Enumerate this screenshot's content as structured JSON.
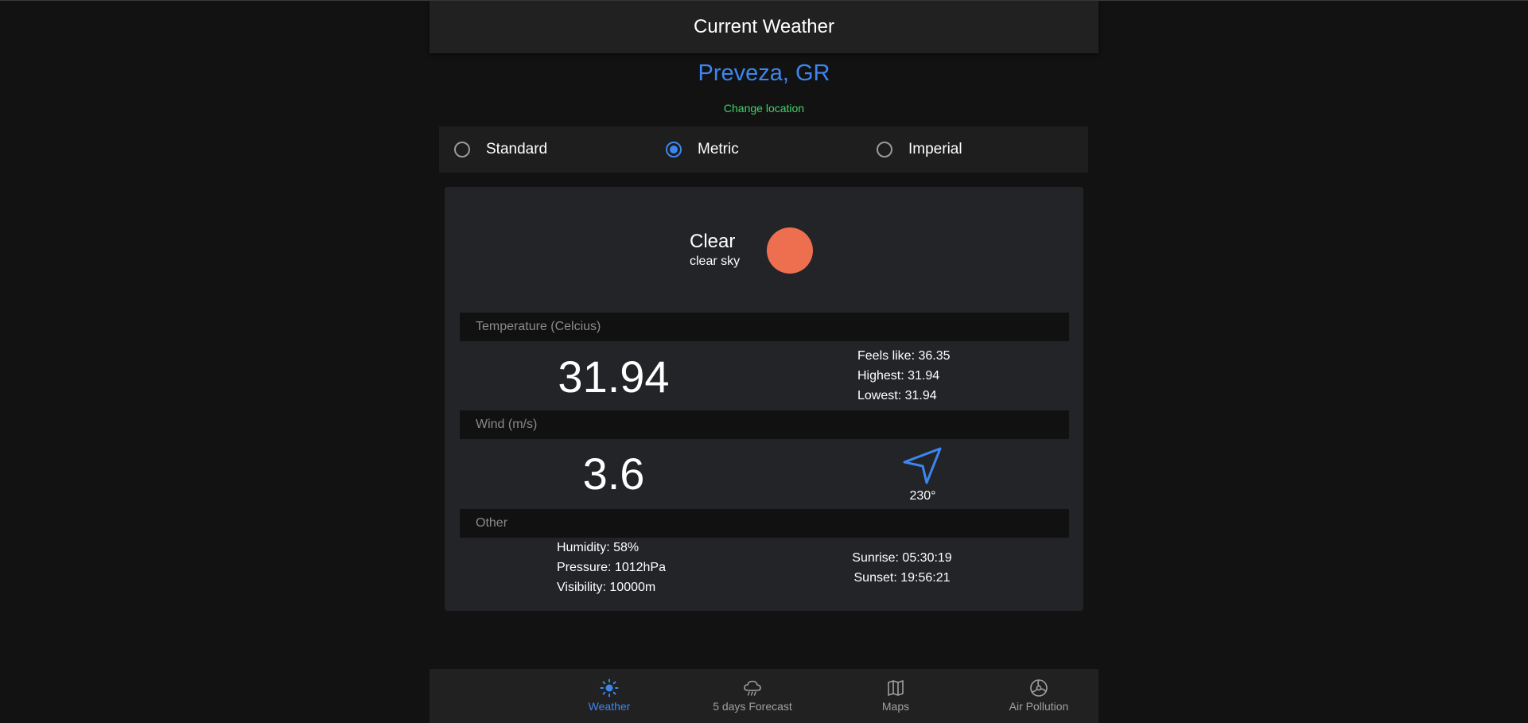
{
  "appbar": {
    "title": "Current Weather"
  },
  "location": {
    "name": "Preveza, GR",
    "change_label": "Change location"
  },
  "units": {
    "options": [
      {
        "label": "Standard",
        "checked": false
      },
      {
        "label": "Metric",
        "checked": true
      },
      {
        "label": "Imperial",
        "checked": false
      }
    ]
  },
  "condition": {
    "main": "Clear",
    "description": "clear sky",
    "icon": "sun-icon"
  },
  "temperature": {
    "header": "Temperature (Celcius)",
    "value": "31.94",
    "feels_like": "Feels like: 36.35",
    "highest": "Highest: 31.94",
    "lowest": "Lowest: 31.94"
  },
  "wind": {
    "header": "Wind (m/s)",
    "speed": "3.6",
    "direction": "230°",
    "icon": "navigation-arrow-icon"
  },
  "other": {
    "header": "Other",
    "humidity": "Humidity: 58%",
    "pressure": "Pressure: 1012hPa",
    "visibility": "Visibility: 10000m",
    "sunrise": "Sunrise: 05:30:19",
    "sunset": "Sunset: 19:56:21"
  },
  "nav": {
    "items": [
      {
        "label": "Weather",
        "icon": "sun-icon",
        "active": true
      },
      {
        "label": "5 days Forecast",
        "icon": "rain-cloud-icon",
        "active": false
      },
      {
        "label": "Maps",
        "icon": "map-icon",
        "active": false
      },
      {
        "label": "Air Pollution",
        "icon": "fan-icon",
        "active": false
      }
    ]
  },
  "colors": {
    "accent": "#3d86f0",
    "link": "#3fd46a",
    "sun": "#ee6f4f"
  }
}
